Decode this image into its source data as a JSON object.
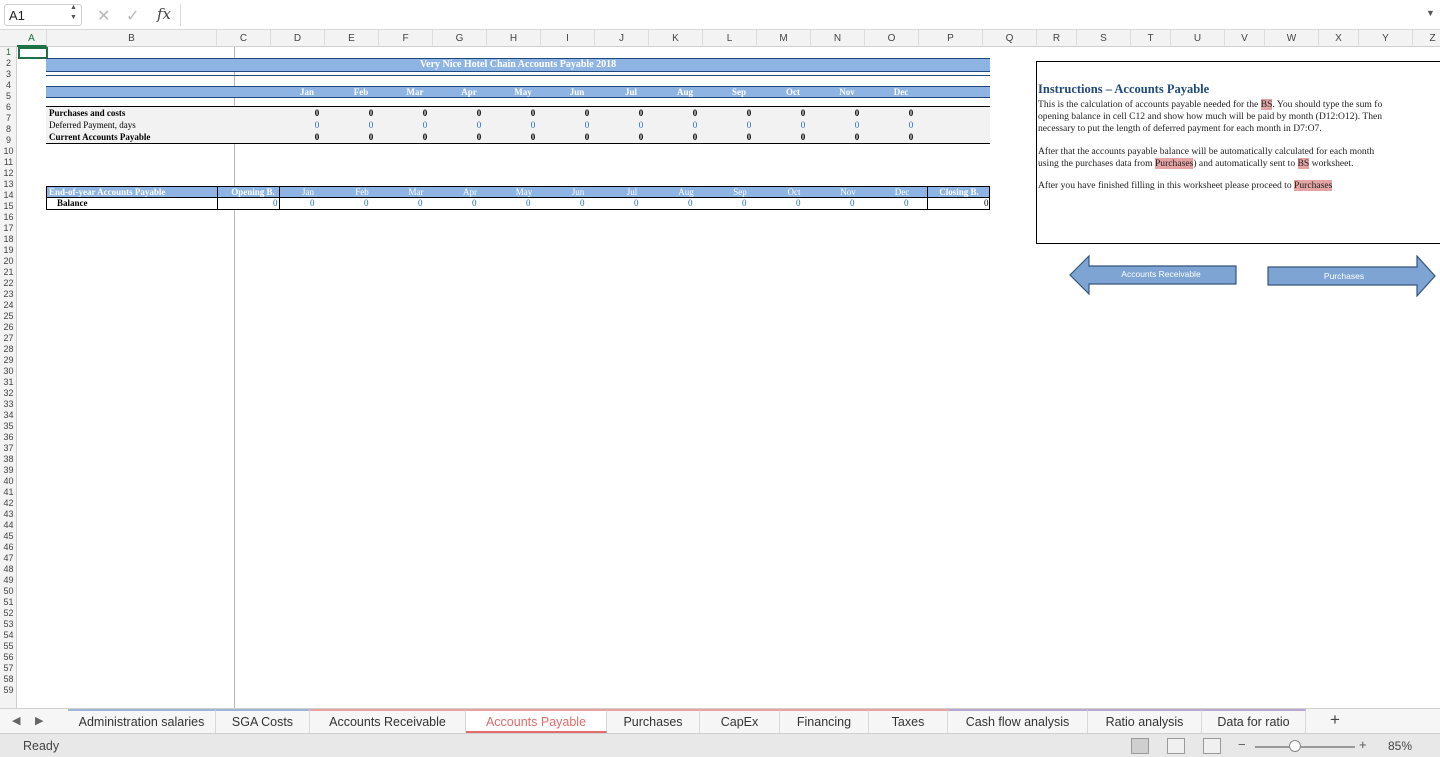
{
  "formula_bar": {
    "name_box": "A1",
    "cancel_icon": "close-icon",
    "enter_icon": "check-icon",
    "fx_label": "fx",
    "formula": ""
  },
  "grid": {
    "columns": [
      "A",
      "B",
      "C",
      "D",
      "E",
      "F",
      "G",
      "H",
      "I",
      "J",
      "K",
      "L",
      "M",
      "N",
      "O",
      "P",
      "Q",
      "R",
      "S",
      "T",
      "U",
      "V",
      "W",
      "X",
      "Y",
      "Z"
    ],
    "rows": [
      "1",
      "2",
      "3",
      "4",
      "5",
      "6",
      "7",
      "8",
      "9",
      "10",
      "11",
      "12",
      "13",
      "14",
      "15",
      "16",
      "17",
      "18",
      "19",
      "20",
      "21",
      "22",
      "23",
      "24",
      "25",
      "26",
      "27",
      "28",
      "29",
      "30",
      "31",
      "32",
      "33",
      "34",
      "35",
      "36",
      "37",
      "38",
      "39",
      "40",
      "41",
      "42",
      "43",
      "44",
      "45",
      "46",
      "47",
      "48",
      "49",
      "50",
      "51",
      "52",
      "53",
      "54",
      "55",
      "56",
      "57",
      "58",
      "59"
    ],
    "selected_cell": "A1"
  },
  "report": {
    "title": "Very Nice Hotel Chain Accounts Payable 2018",
    "months": [
      "Jan",
      "Feb",
      "Mar",
      "Apr",
      "May",
      "Jun",
      "Jul",
      "Aug",
      "Sep",
      "Oct",
      "Nov",
      "Dec"
    ],
    "row_labels": {
      "purchases": "Purchases and costs",
      "deferred": "Deferred Payment, days",
      "current_ap": "Current Accounts Payable"
    },
    "purchases_values": [
      "0",
      "0",
      "0",
      "0",
      "0",
      "0",
      "0",
      "0",
      "0",
      "0",
      "0",
      "0"
    ],
    "deferred_values": [
      "0",
      "0",
      "0",
      "0",
      "0",
      "0",
      "0",
      "0",
      "0",
      "0",
      "0",
      "0"
    ],
    "current_ap_values": [
      "0",
      "0",
      "0",
      "0",
      "0",
      "0",
      "0",
      "0",
      "0",
      "0",
      "0",
      "0"
    ],
    "ap_table": {
      "header_label": "End-of-year Accounts Payable",
      "opening_label": "Opening B.",
      "closing_label": "Closing B.",
      "balance_label": "Balance",
      "opening_value": "0",
      "month_values": [
        "0",
        "0",
        "0",
        "0",
        "0",
        "0",
        "0",
        "0",
        "0",
        "0",
        "0",
        "0"
      ],
      "closing_value": "0"
    }
  },
  "instructions": {
    "title": "Instructions – Accounts Payable",
    "p1_line1_a": "This is the calculation of accounts payable needed for the ",
    "p1_line1_hl": "BS",
    "p1_line1_b": ". You should type the sum fo",
    "p1_line2": "opening balance in cell C12 and show how much will be paid by month (D12:O12). Then",
    "p1_line3": "necessary to put the length of deferred payment for each month in D7:O7.",
    "p2_line1": "After that the accounts payable balance will be automatically calculated for each month",
    "p2_line2_a": "using the purchases data from ",
    "p2_line2_hl1": "Purchases",
    "p2_line2_b": ") and automatically sent to ",
    "p2_line2_hl2": "BS",
    "p2_line2_c": " worksheet.",
    "p3_a": "After you have finished filling in this worksheet please proceed to ",
    "p3_hl": "Purchases"
  },
  "nav_buttons": {
    "back": "Accounts Receivable",
    "forward": "Purchases"
  },
  "sheet_tabs": {
    "items": [
      "Administration salaries",
      "SGA Costs",
      "Accounts Receivable",
      "Accounts Payable",
      "Purchases",
      "CapEx",
      "Financing",
      "Taxes",
      "Cash flow analysis",
      "Ratio analysis",
      "Data for ratio"
    ],
    "active": "Accounts Payable",
    "tab_colors": [
      "#9fb4d9",
      "#9fb4d9",
      "#e8a0a0",
      "#e8a0a0",
      "#e8a0a0",
      "#e8a0a0",
      "#e8a0a0",
      "#e8a0a0",
      "#b9a6d1",
      "#b9a6d1",
      "#b9a6d1"
    ],
    "add_label": "+"
  },
  "status_bar": {
    "status": "Ready",
    "zoom": "85%",
    "zoom_minus": "−",
    "zoom_plus": "+"
  },
  "colors": {
    "header_band": "#8eb4e3",
    "accent_green": "#1e7145",
    "highlight": "#e6a5a5",
    "active_tab": "#e06c6c",
    "input_blue": "#1f6bbf"
  }
}
